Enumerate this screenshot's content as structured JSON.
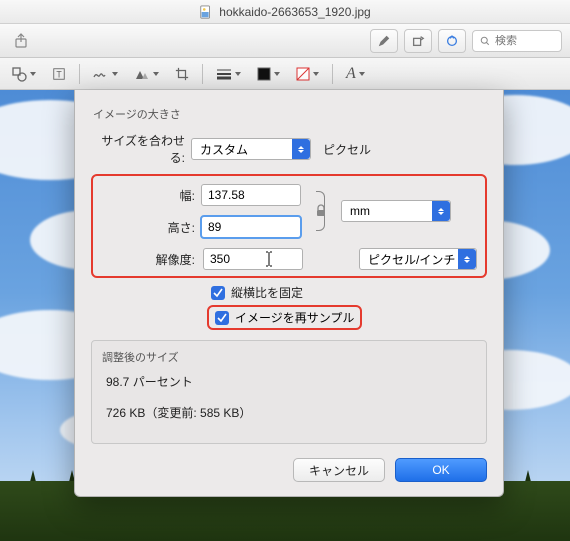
{
  "title": "hokkaido-2663653_1920.jpg",
  "search_placeholder": "検索",
  "dialog": {
    "section_title": "イメージの大きさ",
    "fit_label": "サイズを合わせる:",
    "fit_value": "カスタム",
    "fit_unit_label": "ピクセル",
    "width_label": "幅:",
    "width_value": "137.58",
    "height_label": "高さ:",
    "height_value": "89",
    "unit_value": "mm",
    "resolution_label": "解像度:",
    "resolution_value": "350",
    "resolution_unit": "ピクセル/インチ",
    "lock_ratio_label": "縦横比を固定",
    "resample_label": "イメージを再サンプル",
    "after": {
      "title": "調整後のサイズ",
      "percent": "98.7 パーセント",
      "size": "726 KB（変更前: 585 KB）"
    },
    "cancel": "キャンセル",
    "ok": "OK"
  }
}
